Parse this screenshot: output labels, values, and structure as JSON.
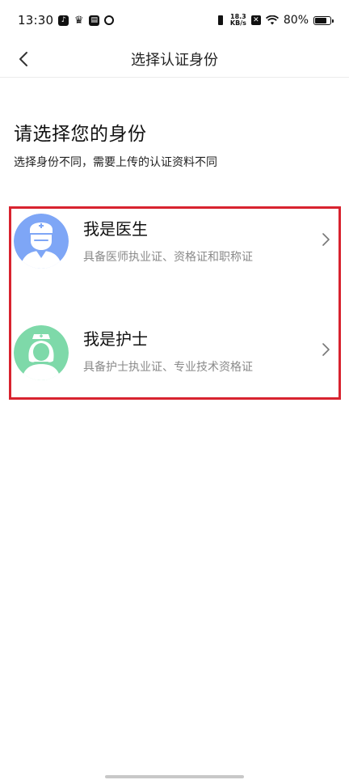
{
  "status_bar": {
    "time": "13:30",
    "speed_value": "18.3",
    "speed_unit": "KB/s",
    "battery_percent": "80%",
    "battery_level": 0.8,
    "icons": [
      "tiktok-icon",
      "crown-icon",
      "box-icon",
      "ring-icon",
      "vibrate-icon",
      "sim-icon",
      "wifi-icon",
      "battery-icon"
    ]
  },
  "nav": {
    "title": "选择认证身份",
    "back_icon": "chevron-left-icon"
  },
  "heading": "请选择您的身份",
  "subheading": "选择身份不同，需要上传的认证资料不同",
  "options": [
    {
      "title": "我是医生",
      "description": "具备医师执业证、资格证和职称证",
      "avatar_icon": "doctor-avatar-icon",
      "avatar_color": "#7ea6f6"
    },
    {
      "title": "我是护士",
      "description": "具备护士执业证、专业技术资格证",
      "avatar_icon": "nurse-avatar-icon",
      "avatar_color": "#7ed9a9"
    }
  ],
  "colors": {
    "highlight_frame": "#d8232f",
    "secondary_text": "#8a8a8a"
  }
}
